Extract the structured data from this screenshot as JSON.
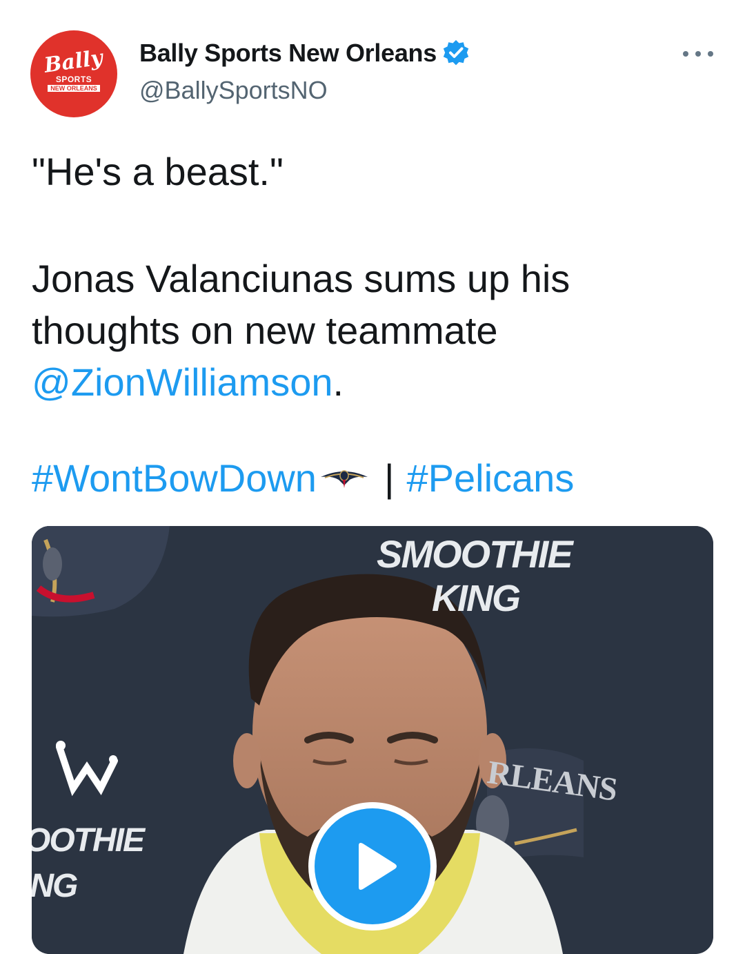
{
  "account": {
    "avatar_brand": "Bally",
    "avatar_sub1": "SPORTS",
    "avatar_sub2": "NEW ORLEANS",
    "display_name": "Bally Sports New Orleans",
    "handle": "@BallySportsNO",
    "verified": true
  },
  "more_icon": "more-horizontal-icon",
  "tweet": {
    "quote": "\"He's a beast.\"",
    "body_line1": "Jonas Valanciunas sums up his",
    "body_line2": "thoughts on new teammate",
    "mention": "@ZionWilliamson",
    "mention_suffix": ".",
    "hashtag1": "#WontBowDown",
    "separator": "|",
    "hashtag2": "#Pelicans"
  },
  "media": {
    "backdrop_text_top_1": "SMOOTHIE",
    "backdrop_text_top_2": "KING",
    "backdrop_text_left_1": "OOTHIE",
    "backdrop_text_left_2": "ING",
    "backdrop_text_right": "RLEANS",
    "play_icon": "play-icon"
  },
  "colors": {
    "link": "#1d9bf0",
    "avatar_bg": "#e0322b",
    "verified": "#1d9bf0",
    "play_button": "#1d9bf0",
    "secondary_text": "#536471"
  }
}
